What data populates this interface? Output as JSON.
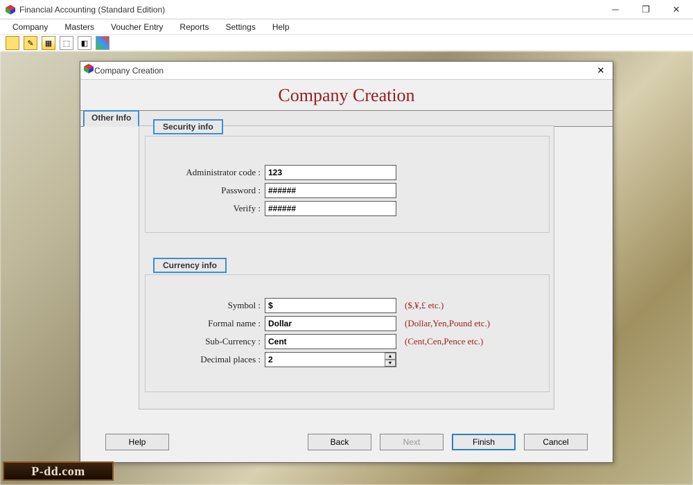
{
  "app": {
    "title": "Financial Accounting (Standard Edition)",
    "menus": [
      "Company",
      "Masters",
      "Voucher Entry",
      "Reports",
      "Settings",
      "Help"
    ]
  },
  "dialog": {
    "title": "Company Creation",
    "heading": "Company Creation",
    "tab_label": "Other Info",
    "security": {
      "legend": "Security info",
      "admin_code_label": "Administrator code :",
      "admin_code_value": "123",
      "password_label": "Password :",
      "password_value": "######",
      "verify_label": "Verify :",
      "verify_value": "######"
    },
    "currency": {
      "legend": "Currency info",
      "symbol_label": "Symbol :",
      "symbol_value": "$",
      "symbol_hint": "($,¥,£ etc.)",
      "formal_label": "Formal name :",
      "formal_value": "Dollar",
      "formal_hint": "(Dollar,Yen,Pound etc.)",
      "sub_label": "Sub-Currency :",
      "sub_value": "Cent",
      "sub_hint": "(Cent,Cen,Pence etc.)",
      "decimal_label": "Decimal places :",
      "decimal_value": "2"
    },
    "buttons": {
      "help": "Help",
      "back": "Back",
      "next": "Next",
      "finish": "Finish",
      "cancel": "Cancel"
    }
  },
  "watermark": "P-dd.com"
}
